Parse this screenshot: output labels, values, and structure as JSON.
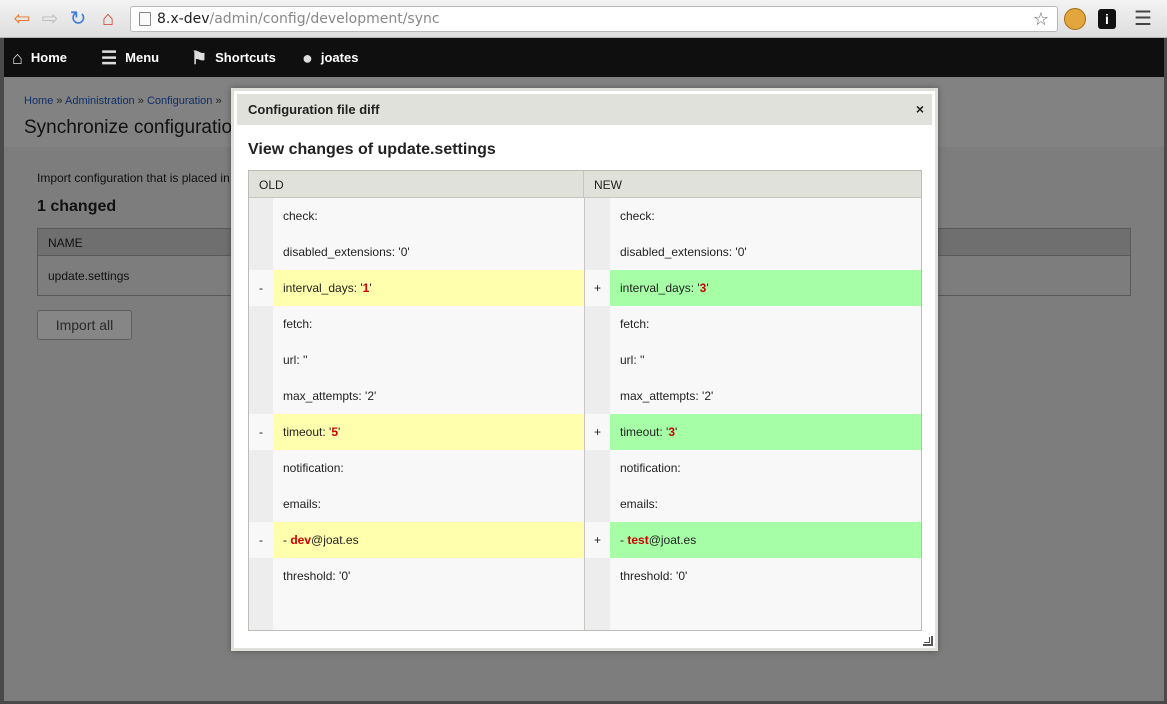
{
  "browser": {
    "url_host": "8.x-dev",
    "url_path": "/admin/config/development/sync",
    "back_icon": "back-arrow-icon",
    "forward_icon": "forward-arrow-icon",
    "reload_icon": "reload-icon",
    "home_icon": "home-icon",
    "bookmark_icon": "star-icon"
  },
  "toolbar": {
    "items": [
      {
        "label": "Home",
        "icon": "home-icon"
      },
      {
        "label": "Menu",
        "icon": "menu-icon"
      },
      {
        "label": "Shortcuts",
        "icon": "bookmark-icon"
      },
      {
        "label": "joates",
        "icon": "user-icon"
      }
    ]
  },
  "page": {
    "breadcrumb": [
      "Home",
      "Administration",
      "Configuration"
    ],
    "breadcrumb_sep": "»",
    "title": "Synchronize configuration",
    "intro": "Import configuration that is placed in",
    "changed_heading": "1 changed",
    "table_header": "NAME",
    "table_row": "update.settings",
    "import_button": "Import all"
  },
  "dialog": {
    "title": "Configuration file diff",
    "close": "×",
    "heading": "View changes of update.settings",
    "col_old": "OLD",
    "col_new": "NEW",
    "rows": [
      {
        "old": "check:",
        "new": "check:",
        "changed": false
      },
      {
        "old": "disabled_extensions: '0'",
        "new": "disabled_extensions: '0'",
        "changed": false
      },
      {
        "old_pre": "interval_days: '",
        "old_hl": "1",
        "old_post": "'",
        "new_pre": "interval_days: '",
        "new_hl": "3",
        "new_post": "'",
        "old_mark": "-",
        "new_mark": "+",
        "changed": true
      },
      {
        "old": "fetch:",
        "new": "fetch:",
        "changed": false
      },
      {
        "old": "url: ''",
        "new": "url: ''",
        "changed": false
      },
      {
        "old": "max_attempts: '2'",
        "new": "max_attempts: '2'",
        "changed": false
      },
      {
        "old_pre": "timeout: '",
        "old_hl": "5",
        "old_post": "'",
        "new_pre": "timeout: '",
        "new_hl": "3",
        "new_post": "'",
        "old_mark": "-",
        "new_mark": "+",
        "changed": true
      },
      {
        "old": "notification:",
        "new": "notification:",
        "changed": false
      },
      {
        "old": "emails:",
        "new": "emails:",
        "changed": false
      },
      {
        "old_pre": "- ",
        "old_hl": "dev",
        "old_post": "@joat.es",
        "new_pre": "- ",
        "new_hl": "test",
        "new_post": "@joat.es",
        "old_mark": "-",
        "new_mark": "+",
        "changed": true
      },
      {
        "old": "threshold: '0'",
        "new": "threshold: '0'",
        "changed": false
      },
      {
        "old": "",
        "new": "",
        "changed": false
      }
    ]
  },
  "colors": {
    "removed_bg": "#ffffae",
    "added_bg": "#a6ffa6",
    "highlight_text": "#cc0000",
    "toolbar_bg": "#0f0f0f"
  }
}
